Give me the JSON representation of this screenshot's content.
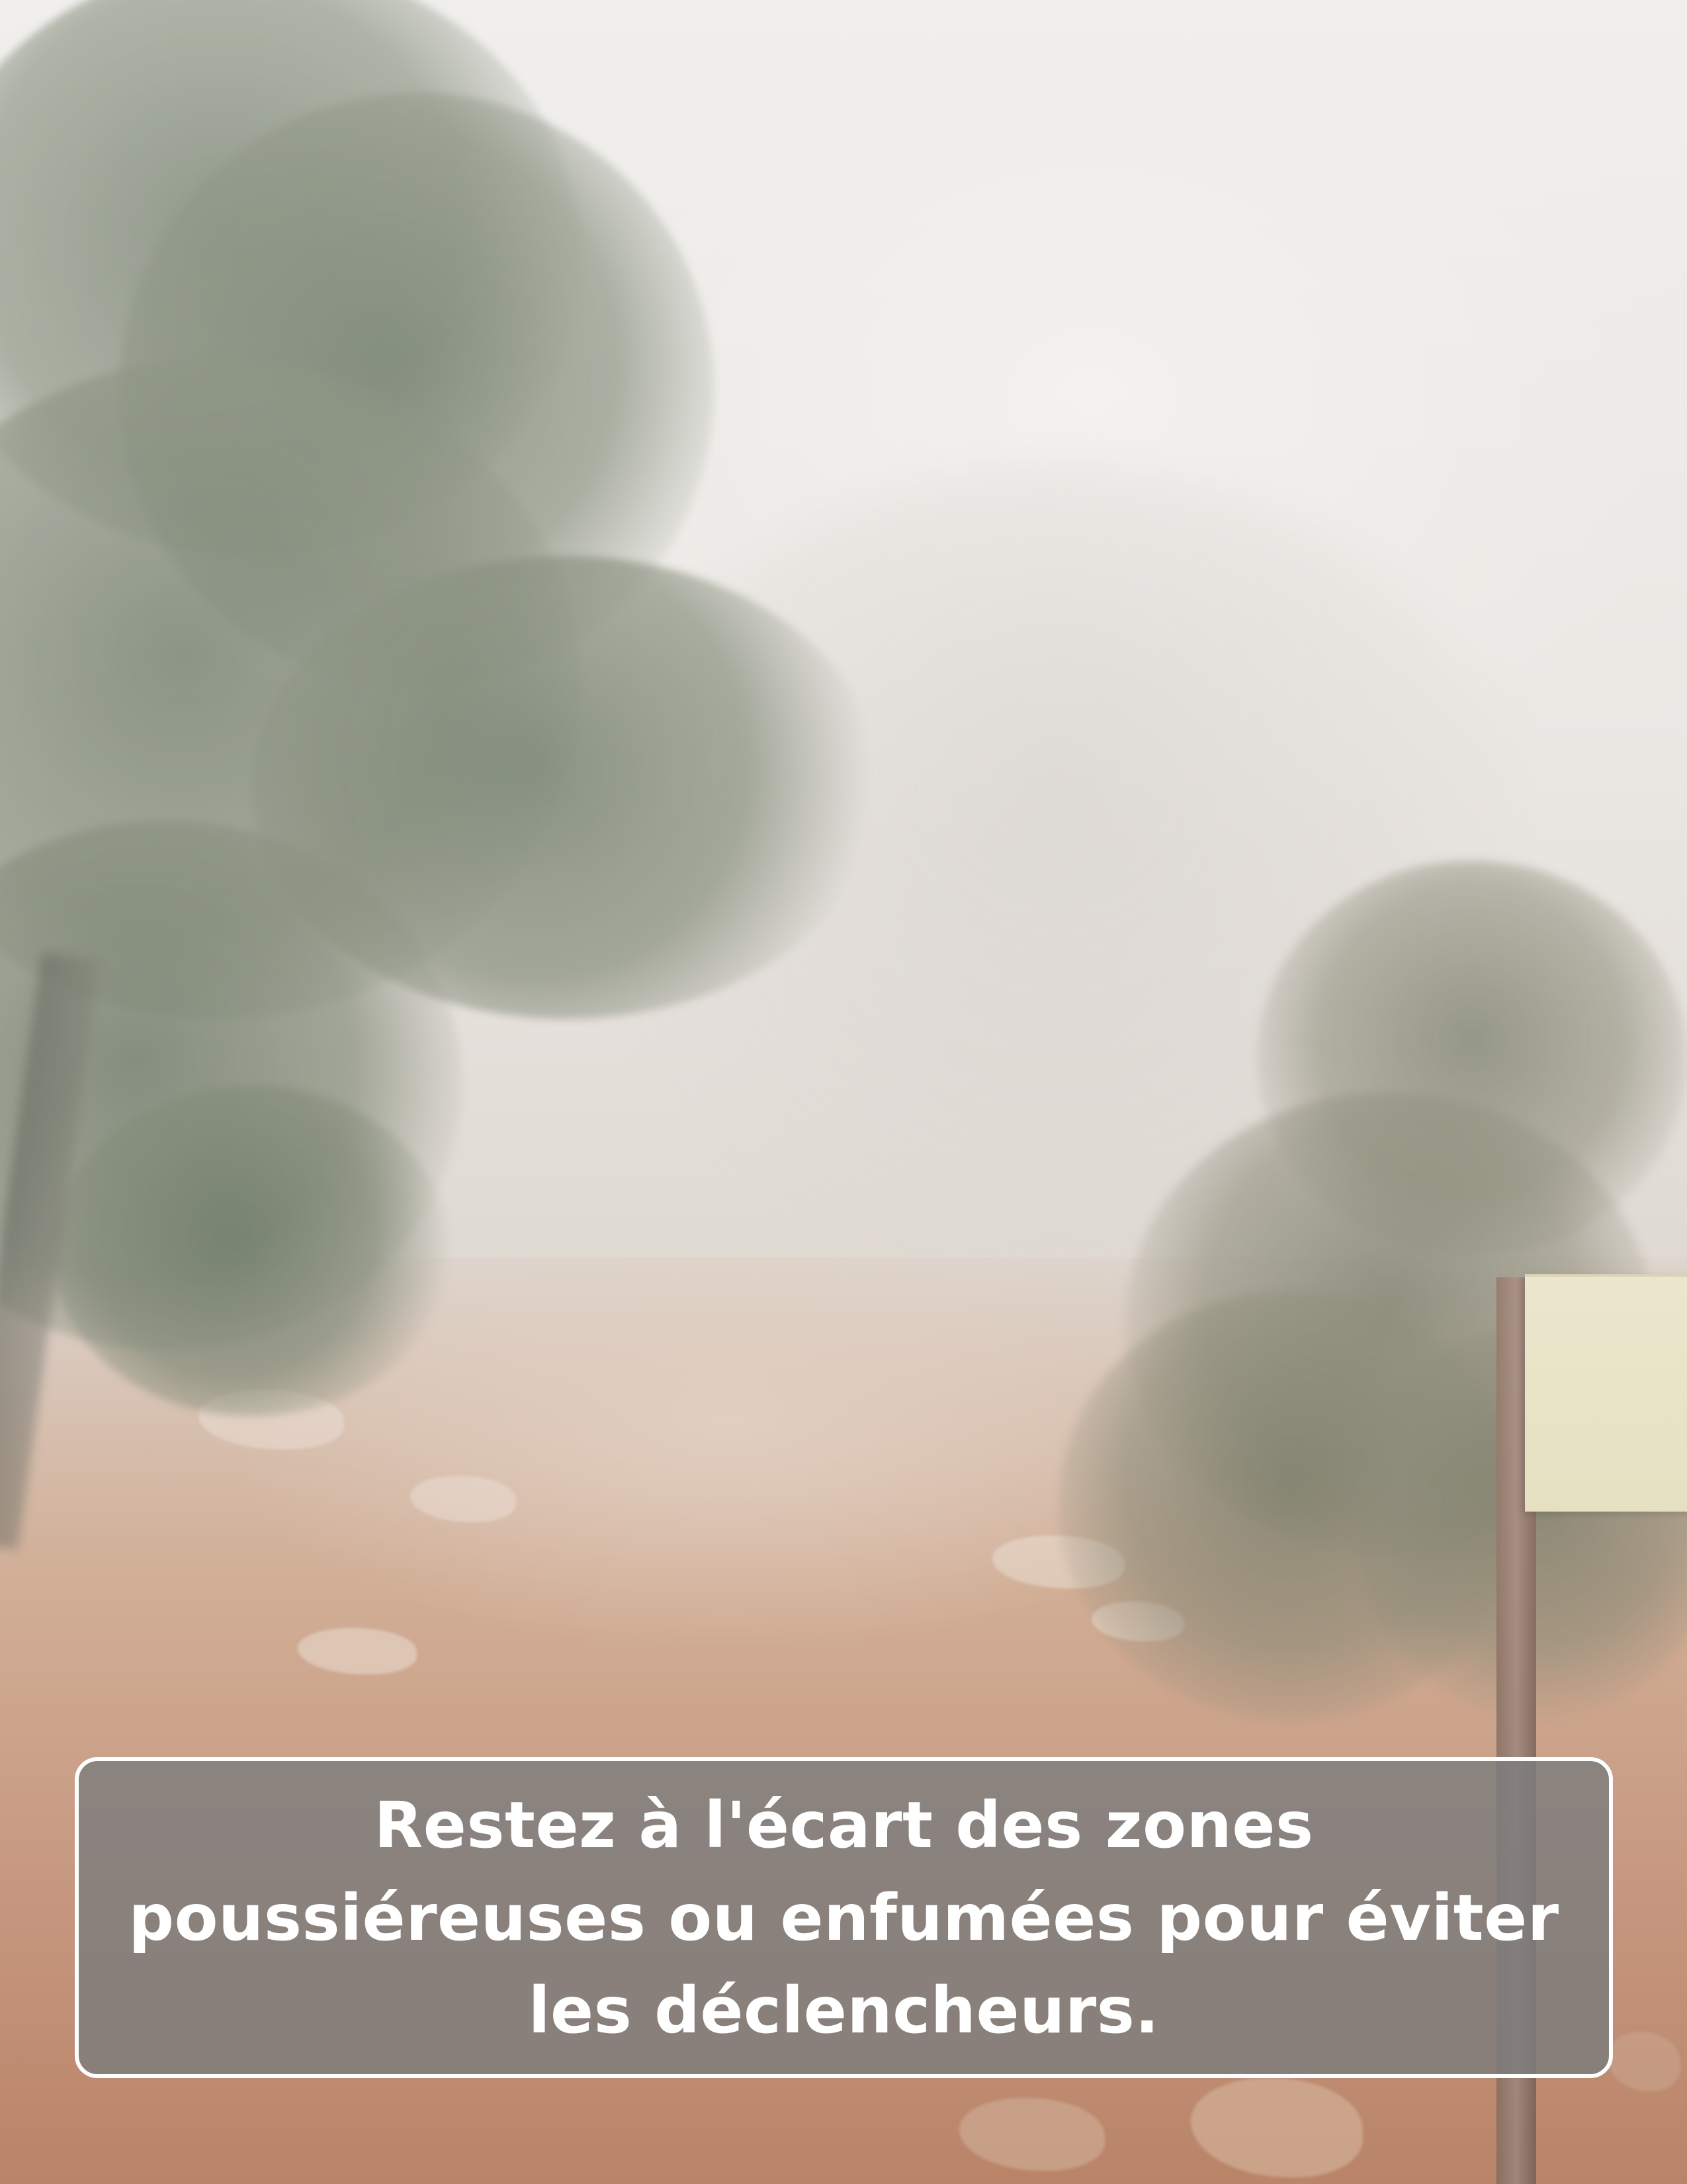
{
  "scene": {
    "description_elements": [
      "foggy-sky",
      "left-tree",
      "right-tree",
      "dirt-path",
      "sign-post"
    ]
  },
  "caption": {
    "text": "Restez à l'écart des zones poussiéreuses ou enfumées pour éviter les déclencheurs."
  },
  "colors": {
    "caption_background": "#7d7d7d",
    "caption_border": "#ffffff",
    "caption_text": "#ffffff",
    "sign_board": "#e6e0c0"
  }
}
